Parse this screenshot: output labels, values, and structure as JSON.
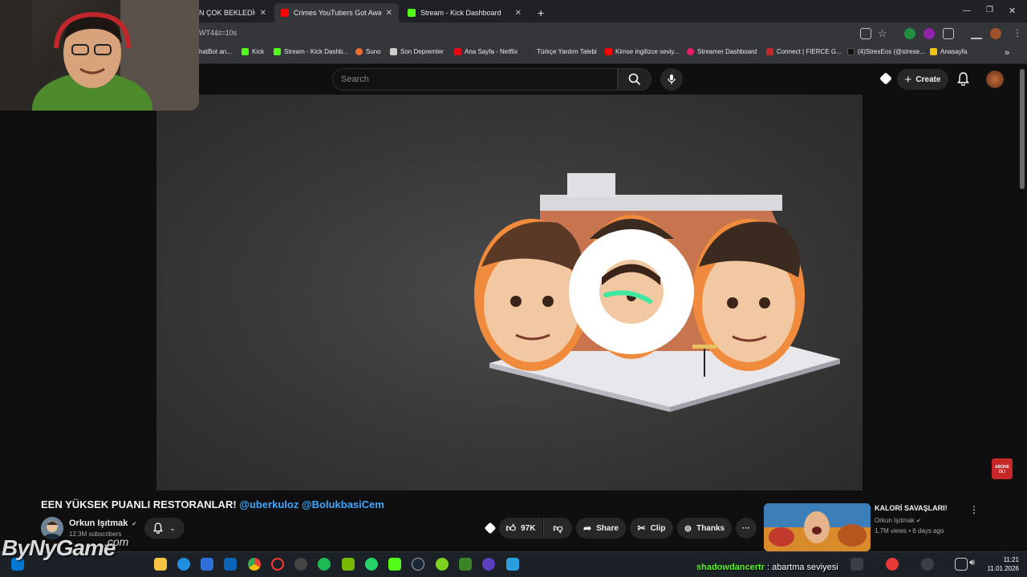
{
  "browser": {
    "tabs": [
      {
        "label": "N ÇOK BEKLEDİĞİM",
        "color": "#ff0000"
      },
      {
        "label": "Crimes YouTubers Got Away W",
        "color": "#ff0000"
      },
      {
        "label": "Stream - Kick Dashboard",
        "color": "#53fc18"
      }
    ],
    "new_tab": "+",
    "url": "WT4&t=10s",
    "bookmarks": [
      {
        "label": "hatBot an...",
        "color": "#888888"
      },
      {
        "label": "Kick",
        "color": "#53fc18"
      },
      {
        "label": "Stream - Kick Dashb...",
        "color": "#53fc18"
      },
      {
        "label": "Suno",
        "color": "#f46b2e"
      },
      {
        "label": "Son Depremler",
        "color": "#cccccc"
      },
      {
        "label": "Ana Sayfa - Netflix",
        "color": "#e50914"
      },
      {
        "label": "Türkçe Yardım Talebi",
        "color": "#333333"
      },
      {
        "label": "Kimse ingilizce seviy...",
        "color": "#ff0000"
      },
      {
        "label": "Streamer Dashboard",
        "color": "#e91e63"
      },
      {
        "label": "Connect | FIERCE G...",
        "color": "#c62828"
      },
      {
        "label": "(4)StresEos (@strese...",
        "color": "#111111"
      },
      {
        "label": "Anasayfa",
        "color": "#f1c40f"
      }
    ],
    "more_bookmarks": "»"
  },
  "youtube": {
    "search_placeholder": "Search",
    "create_label": "Create",
    "video": {
      "title_prefix": "EEN YÜKSEK PUANLI RESTORANLAR! ",
      "title_tags": "@uberkuloz @BolukbasiCem",
      "channel": "Orkun Işıtmak",
      "verified": "✔",
      "subscribers": "12.3M subscribers",
      "likes": "97K",
      "share_label": "Share",
      "clip_label": "Clip",
      "thanks_label": "Thanks",
      "more_label": "···"
    },
    "recommendation": {
      "title": "KALORİ SAVAŞLARI!",
      "channel": "Orkun Işıtmak",
      "verified": "✔",
      "meta": "1.7M views • 8 days ago"
    },
    "subscribe_badge": "ABONE OL!"
  },
  "overlay": {
    "watermark": "ByNyGame",
    "watermark_suffix": ".com",
    "chat_user": "shadowdancertr",
    "chat_message": " : abartma seviyesi"
  },
  "taskbar": {
    "time": "11:21",
    "date": "11.01.2026"
  }
}
